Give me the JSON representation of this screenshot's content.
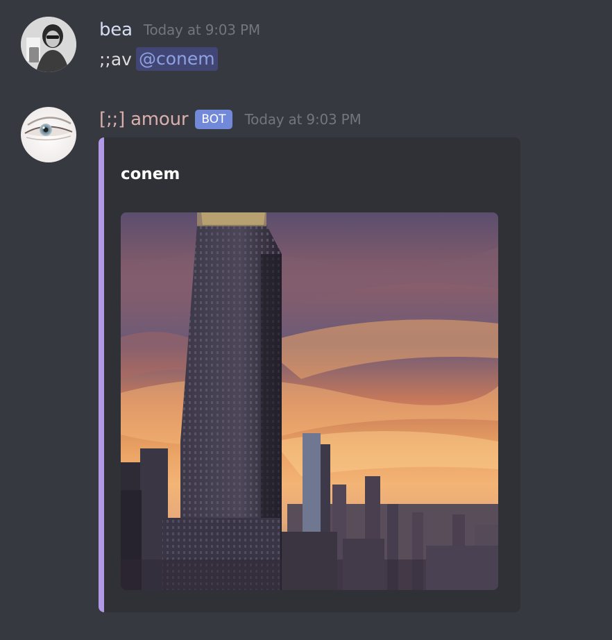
{
  "messages": [
    {
      "author": "bea",
      "timestamp": "Today at 9:03 PM",
      "content_prefix": ";;av",
      "mention": "@conem"
    },
    {
      "author": "[;;] amour",
      "badge": "BOT",
      "timestamp": "Today at 9:03 PM",
      "embed": {
        "title": "conem",
        "accent_color": "#b199e8"
      }
    }
  ],
  "colors": {
    "background": "#36393f",
    "embed_background": "#2f3136",
    "bot_badge": "#7289da",
    "mention_background": "#414675",
    "mention_text": "#8ea1e1"
  }
}
